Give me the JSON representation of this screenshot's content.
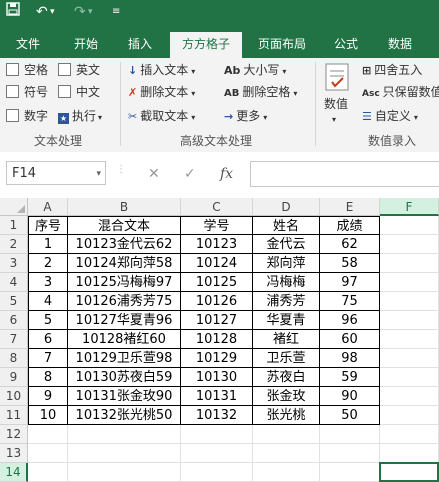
{
  "quick_access": {
    "save_icon": "save-icon",
    "undo_icon": "undo-icon",
    "redo_icon": "redo-icon",
    "customize_icon": "customize-icon"
  },
  "tabs": [
    "文件",
    "开始",
    "插入",
    "方方格子",
    "页面布局",
    "公式",
    "数据"
  ],
  "active_tab": "方方格子",
  "ribbon": {
    "text_processing": {
      "checkboxes": [
        "空格",
        "英文",
        "符号",
        "中文",
        "数字"
      ],
      "execute_label": "执行",
      "group_label": "文本处理"
    },
    "advanced_text": {
      "insert_text": "插入文本",
      "delete_text": "删除文本",
      "extract_text": "截取文本",
      "case": "大小写",
      "delete_spaces": "删除空格",
      "more": "更多",
      "group_label": "高级文本处理"
    },
    "numeric": {
      "numeric_label": "数值",
      "round": "四舍五入",
      "keep_values": "只保留数值",
      "custom": "自定义",
      "group_label": "数值录入"
    }
  },
  "formula_bar": {
    "name_box": "F14",
    "cancel": "✕",
    "confirm": "✓",
    "fx": "fx",
    "formula": ""
  },
  "columns": [
    "A",
    "B",
    "C",
    "D",
    "E",
    "F"
  ],
  "selected_column": "F",
  "rows": [
    "1",
    "2",
    "3",
    "4",
    "5",
    "6",
    "7",
    "8",
    "9",
    "10",
    "11",
    "12",
    "13",
    "14"
  ],
  "selected_row": "14",
  "table": {
    "headers": [
      "序号",
      "混合文本",
      "学号",
      "姓名",
      "成绩"
    ],
    "data": [
      [
        "1",
        "10123金代云62",
        "10123",
        "金代云",
        "62"
      ],
      [
        "2",
        "10124郑向萍58",
        "10124",
        "郑向萍",
        "58"
      ],
      [
        "3",
        "10125冯梅梅97",
        "10125",
        "冯梅梅",
        "97"
      ],
      [
        "4",
        "10126浦秀芳75",
        "10126",
        "浦秀芳",
        "75"
      ],
      [
        "5",
        "10127华夏青96",
        "10127",
        "华夏青",
        "96"
      ],
      [
        "6",
        "10128褚红60",
        "10128",
        "褚红",
        "60"
      ],
      [
        "7",
        "10129卫乐萱98",
        "10129",
        "卫乐萱",
        "98"
      ],
      [
        "8",
        "10130苏夜白59",
        "10130",
        "苏夜白",
        "59"
      ],
      [
        "9",
        "10131张金玫90",
        "10131",
        "张金玫",
        "90"
      ],
      [
        "10",
        "10132张光桃50",
        "10132",
        "张光桃",
        "50"
      ]
    ]
  },
  "colors": {
    "brand": "#217346",
    "ribbon_bg": "#f3f3f3"
  }
}
